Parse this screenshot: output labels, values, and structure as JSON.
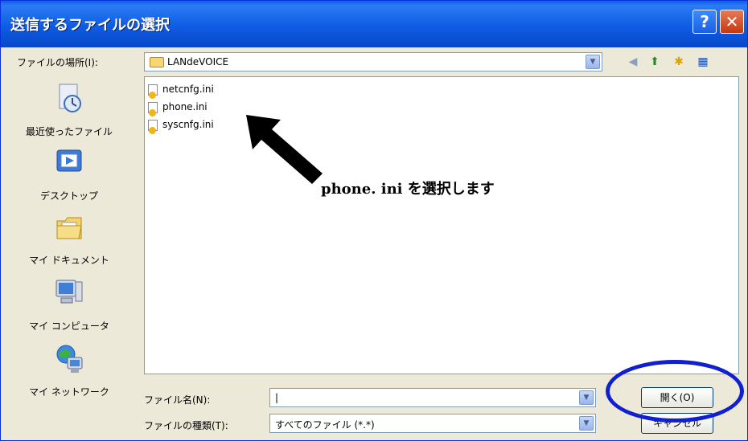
{
  "window": {
    "title": "送信するファイルの選択",
    "help_label": "?",
    "close_label": "✕"
  },
  "look_in": {
    "label": "ファイルの場所(I):",
    "value": "LANdeVOICE"
  },
  "toolbar_icons": [
    "back-icon",
    "up-folder-icon",
    "new-folder-icon",
    "views-menu-icon"
  ],
  "places": [
    {
      "label": "最近使ったファイル",
      "icon": "recent-files-icon"
    },
    {
      "label": "デスクトップ",
      "icon": "desktop-icon"
    },
    {
      "label": "マイ ドキュメント",
      "icon": "my-documents-icon"
    },
    {
      "label": "マイ コンピュータ",
      "icon": "my-computer-icon"
    },
    {
      "label": "マイ ネットワーク",
      "icon": "my-network-icon"
    }
  ],
  "files": [
    "netcnfg.ini",
    "phone.ini",
    "syscnfg.ini"
  ],
  "annotation": "phone. ini を選択します",
  "file_name": {
    "label": "ファイル名(N):",
    "value": "|"
  },
  "file_type": {
    "label": "ファイルの種類(T):",
    "value": "すべてのファイル (*.*)"
  },
  "buttons": {
    "open": "開く(O)",
    "cancel": "キャンセル"
  },
  "colors": {
    "titlebar": "#0a5de6",
    "annotation_circle": "#1020d0",
    "dialog_bg": "#ece9d8"
  }
}
